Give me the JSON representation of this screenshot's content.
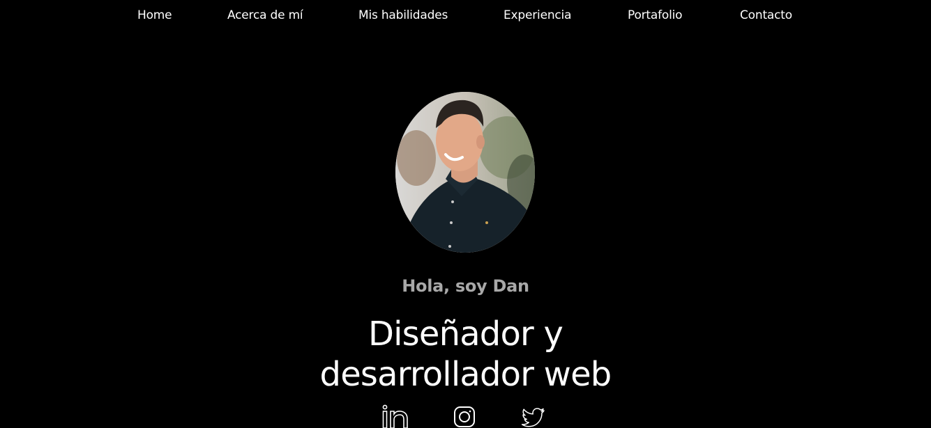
{
  "nav": {
    "items": [
      {
        "label": "Home"
      },
      {
        "label": "Acerca de mí"
      },
      {
        "label": "Mis habilidades"
      },
      {
        "label": "Experiencia"
      },
      {
        "label": "Portafolio"
      },
      {
        "label": "Contacto"
      }
    ]
  },
  "hero": {
    "greeting": "Hola, soy Dan",
    "title_line1": "Diseñador y",
    "title_line2": "desarrollador web",
    "avatar_icon": "profile-photo"
  },
  "social": {
    "icons": [
      "linkedin-icon",
      "instagram-icon",
      "twitter-icon"
    ]
  },
  "colors": {
    "background": "#000000",
    "text": "#ffffff",
    "greeting": "#a8a8a8"
  }
}
